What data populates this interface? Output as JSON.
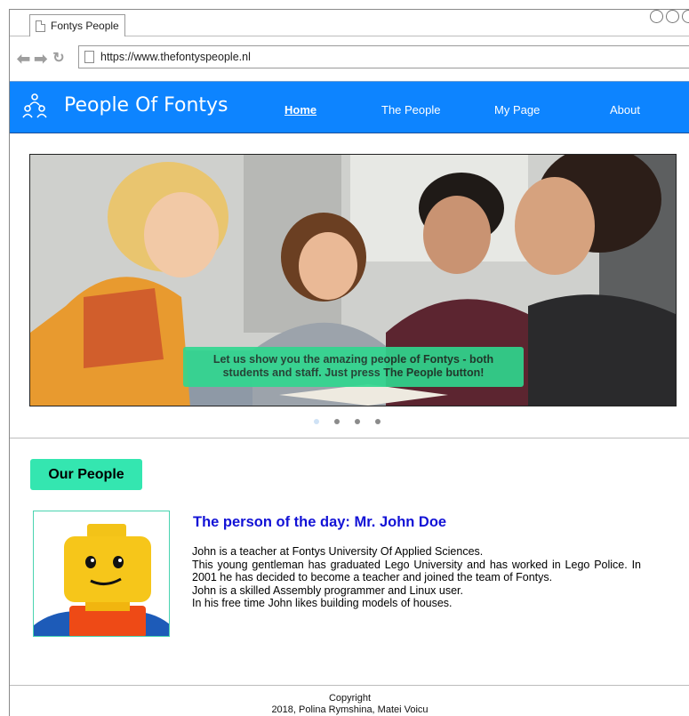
{
  "browser": {
    "tab_title": "Fontys People",
    "url": "https://www.thefontyspeople.nl"
  },
  "header": {
    "brand": "People Of Fontys",
    "logo_icon": "people-network-icon",
    "nav": [
      {
        "label": "Home",
        "active": true
      },
      {
        "label": "The People",
        "active": false
      },
      {
        "label": "My Page",
        "active": false
      },
      {
        "label": "About",
        "active": false
      }
    ],
    "color": "#0d84ff"
  },
  "carousel": {
    "caption_line1": "Let us show you the amazing people of Fontys - both",
    "caption_line2": "students and staff. Just press The People button!",
    "slide_count": 4,
    "active_slide": 1
  },
  "people_section": {
    "heading": "Our People",
    "person_title": "The person of the day: Mr. John Doe",
    "bio": [
      "John is a teacher at Fontys University Of Applied Sciences.",
      "This young gentleman has graduated Lego University and has worked in Lego Police. In 2001 he has decided to become a teacher and joined the team of Fontys.",
      "John is a skilled Assembly programmer and Linux user.",
      "In his free time John likes building models of houses."
    ]
  },
  "footer": {
    "line1": "Copyright",
    "line2": "2018, Polina Rymshina, Matei Voicu"
  }
}
